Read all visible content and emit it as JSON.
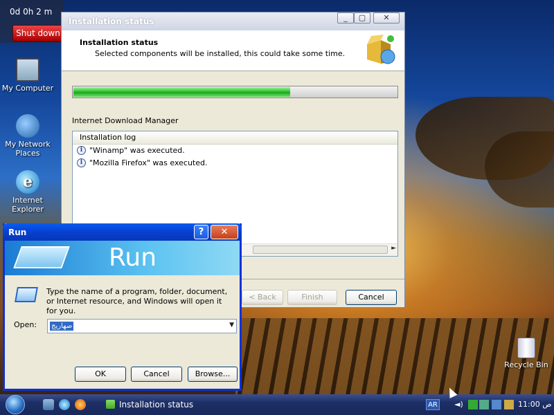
{
  "desktop": {
    "timer": {
      "text": "0d 0h 2 m",
      "shutdown_label": "Shut down"
    },
    "icons": [
      {
        "label": "My Computer"
      },
      {
        "label": "My Network Places"
      },
      {
        "label": "Internet Explorer"
      },
      {
        "label": "Recycle Bin"
      }
    ]
  },
  "installer": {
    "title": "Installation status",
    "header_title": "Installation status",
    "header_subtitle": "Selected components will be installed, this could take some time.",
    "progress_fraction": 0.67,
    "status_text": "Internet Download Manager",
    "log_header": "Installation log",
    "log_entries": [
      "\"Winamp\" was executed.",
      "\"Mozilla Firefox\" was executed."
    ],
    "buttons": {
      "back": "< Back",
      "finish": "Finish",
      "cancel": "Cancel"
    }
  },
  "run_dialog": {
    "title": "Run",
    "help_label": "?",
    "banner_text": "Run",
    "description": "Type the name of a program, folder, document, or Internet resource, and Windows will open it for you.",
    "open_label": "Open:",
    "open_value": "صهاريج",
    "buttons": {
      "ok": "OK",
      "cancel": "Cancel",
      "browse": "Browse..."
    }
  },
  "taskbar": {
    "task_label": "Installation status",
    "language": "AR",
    "clock": "11:00 ص"
  },
  "colors": {
    "progress": "#2fc42f",
    "title_bar": "#0840d0",
    "close": "#c3411b"
  }
}
